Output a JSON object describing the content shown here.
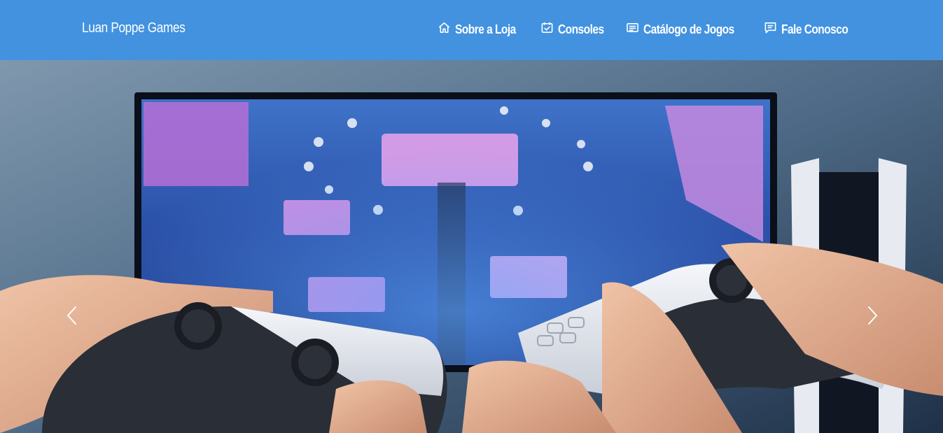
{
  "navbar": {
    "brand": "Luan Poppe Games",
    "links": [
      {
        "label": "Sobre a Loja",
        "icon": "home-icon"
      },
      {
        "label": "Consoles",
        "icon": "calendar-check-icon"
      },
      {
        "label": "Catálogo de Jogos",
        "icon": "list-card-icon"
      },
      {
        "label": "Fale Conosco",
        "icon": "chat-icon"
      }
    ],
    "color": "#4292e0"
  },
  "carousel": {
    "image": "photo-hands-holding-game-controllers-in-front-of-tv",
    "prev_icon": "chevron-left-icon",
    "next_icon": "chevron-right-icon"
  }
}
